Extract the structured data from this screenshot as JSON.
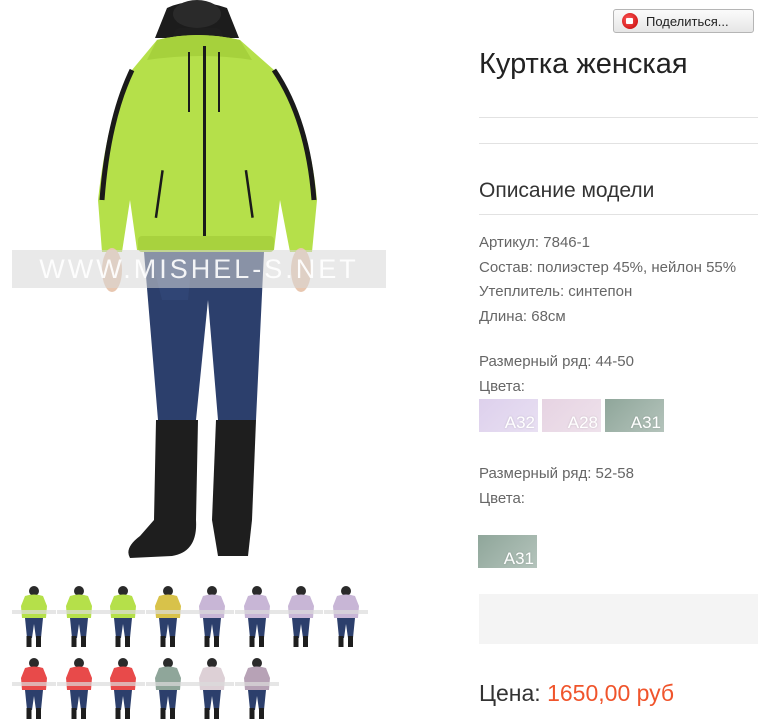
{
  "colors": {
    "jacket_green": "#b5e04a",
    "jacket_trim": "#1a1a1a",
    "jeans": "#2c3f6c",
    "boots": "#1e1e1e",
    "price_accent": "#f0542b"
  },
  "photo": {
    "watermark": "WWW.MISHEL-S.NET"
  },
  "share": {
    "label": "Поделиться...",
    "icon": "share-icon"
  },
  "product": {
    "title": "Куртка женская",
    "section_title": "Описание модели",
    "specs": [
      "Артикул: 7846-1",
      "Состав: полиэстер 45%, нейлон 55%",
      "Утеплитель: синтепон",
      "Длина: 68см"
    ]
  },
  "sizes": [
    {
      "range": "Размерный ряд: 44-50",
      "colors_label": "Цвета:",
      "swatches": [
        {
          "code": "A32",
          "color": "#ddd0ec"
        },
        {
          "code": "A28",
          "color": "#e6d3e2"
        },
        {
          "code": "A31",
          "color": "#8fa69a"
        }
      ]
    },
    {
      "range": "Размерный ряд: 52-58",
      "colors_label": "Цвета:",
      "swatches": [
        {
          "code": "A31",
          "color": "#8fa69a"
        }
      ]
    }
  ],
  "thumbnails": [
    {
      "color": "#b5e04a"
    },
    {
      "color": "#b5e04a"
    },
    {
      "color": "#b5e04a"
    },
    {
      "color": "#d8c24a"
    },
    {
      "color": "#c8b6d6"
    },
    {
      "color": "#c8b6d6"
    },
    {
      "color": "#c8b6d6"
    },
    {
      "color": "#c8b6d6"
    },
    {
      "color": "#e84a4a"
    },
    {
      "color": "#e84a4a"
    },
    {
      "color": "#e84a4a"
    },
    {
      "color": "#8fa69a"
    },
    {
      "color": "#ddd0d6"
    },
    {
      "color": "#b7a2b6"
    }
  ],
  "price": {
    "label": "Цена:",
    "value": "1650,00 руб"
  }
}
